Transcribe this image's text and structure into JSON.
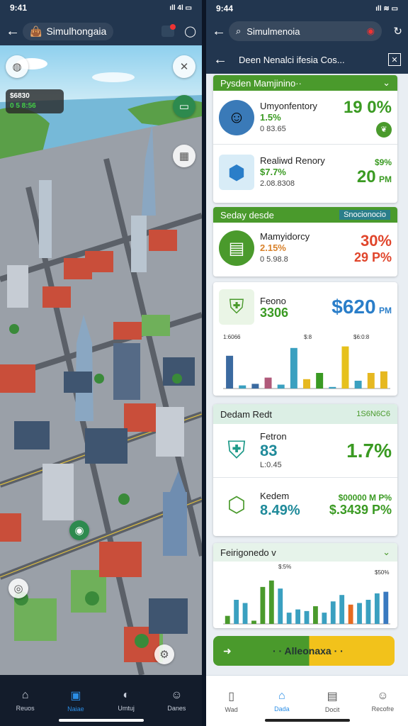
{
  "left_phone": {
    "status_time": "9:41",
    "status_icons": "ıll 4l ▭",
    "app_title": "Simulhongaia",
    "hud": {
      "line1": "$6830",
      "line2": "0 5 8:56"
    },
    "nav": [
      {
        "label": "Reuos",
        "icon": "home-outline-icon"
      },
      {
        "label": "Naiae",
        "icon": "home-icon"
      },
      {
        "label": "Umtuj",
        "icon": "globe-icon"
      },
      {
        "label": "Danes",
        "icon": "people-icon"
      }
    ]
  },
  "right_phone": {
    "status_time": "9:44",
    "status_icons": "ıll ≋ ▭",
    "search_text": "Simulmenoia",
    "subheader_title": "Deen Nenalci ifesia Cos...",
    "sections": {
      "production": {
        "title": "Pysden Mamjinino··",
        "items": [
          {
            "name": "Umyonfentory",
            "pct": "1.5%",
            "sub": "0 83.65",
            "value": "19 0%"
          },
          {
            "name": "Realiwd Renory",
            "pct": "$7.7%",
            "sub": "2.08.8308",
            "value": "20",
            "value_unit": "PM",
            "value_top": "$9%"
          }
        ]
      },
      "supply": {
        "title": "Seday desde",
        "badge": "Snocionocio",
        "items": [
          {
            "name": "Mamyidorcy",
            "pct": "2.15%",
            "sub": "0 5.98.8",
            "value": "30%",
            "value2": "29 P%"
          }
        ]
      },
      "finance": {
        "name": "Feono",
        "pct": "3306",
        "value": "$620",
        "value_unit": "PM",
        "chart_labels": [
          "1:6066",
          "$:8",
          "$6:0:8"
        ]
      },
      "demand": {
        "title": "Dedam Redt",
        "badge": "1S6N6C6",
        "items": [
          {
            "name": "Fetron",
            "value": "83",
            "sub": "L:0.45",
            "right": "1.7%"
          },
          {
            "name": "Kedem",
            "value": "8.49%",
            "right_top": "$00000 M P%",
            "right": "$.3439 P%"
          }
        ]
      },
      "trend": {
        "title": "Feirigonedo v",
        "label_a": "$:5%",
        "label_b": "$50%"
      }
    },
    "cta_label": "· · Alleonaxa · ·",
    "nav": [
      {
        "label": "Wad",
        "icon": "phone-icon"
      },
      {
        "label": "Dada",
        "icon": "home-icon"
      },
      {
        "label": "Docit",
        "icon": "document-icon"
      },
      {
        "label": "Recofre",
        "icon": "person-icon"
      }
    ]
  },
  "chart_data": [
    {
      "type": "bar",
      "categories": [
        "1",
        "2",
        "3",
        "4",
        "5",
        "6",
        "7",
        "8",
        "9",
        "10",
        "11",
        "12",
        "13"
      ],
      "series": [
        {
          "values": [
            42,
            4,
            6,
            14,
            5,
            52,
            12,
            20,
            2,
            54,
            10,
            20,
            22
          ]
        }
      ],
      "bar_colors": [
        "#3b6aa0",
        "#3aa0c0",
        "#3b6aa0",
        "#b05a7a",
        "#3aa0c0",
        "#3aa0c0",
        "#e6b820",
        "#3a9a22",
        "#3aa0c0",
        "#e6c11c",
        "#3aa0c0",
        "#e6b820",
        "#e6b820"
      ],
      "ylim": [
        0,
        60
      ]
    },
    {
      "type": "bar",
      "categories": [
        "1",
        "2",
        "3",
        "4",
        "5",
        "6",
        "7",
        "8",
        "9",
        "10",
        "11",
        "12",
        "13",
        "14",
        "15",
        "16",
        "17",
        "18",
        "19"
      ],
      "series": [
        {
          "values": [
            10,
            30,
            26,
            4,
            46,
            54,
            44,
            14,
            18,
            16,
            22,
            14,
            28,
            36,
            24,
            26,
            30,
            38,
            40
          ]
        }
      ],
      "bar_colors": [
        "#4a9a2c",
        "#3aa0c0",
        "#3aa0c0",
        "#4a9a2c",
        "#4a9a2c",
        "#4a9a2c",
        "#3aa0c0",
        "#3aa0c0",
        "#3aa0c0",
        "#3aa0c0",
        "#4a9a2c",
        "#3aa0c0",
        "#3aa0c0",
        "#3aa0c0",
        "#e66a20",
        "#3aa0c0",
        "#3aa0c0",
        "#3aa0c0",
        "#3a7ac0"
      ],
      "ylim": [
        0,
        60
      ]
    }
  ]
}
